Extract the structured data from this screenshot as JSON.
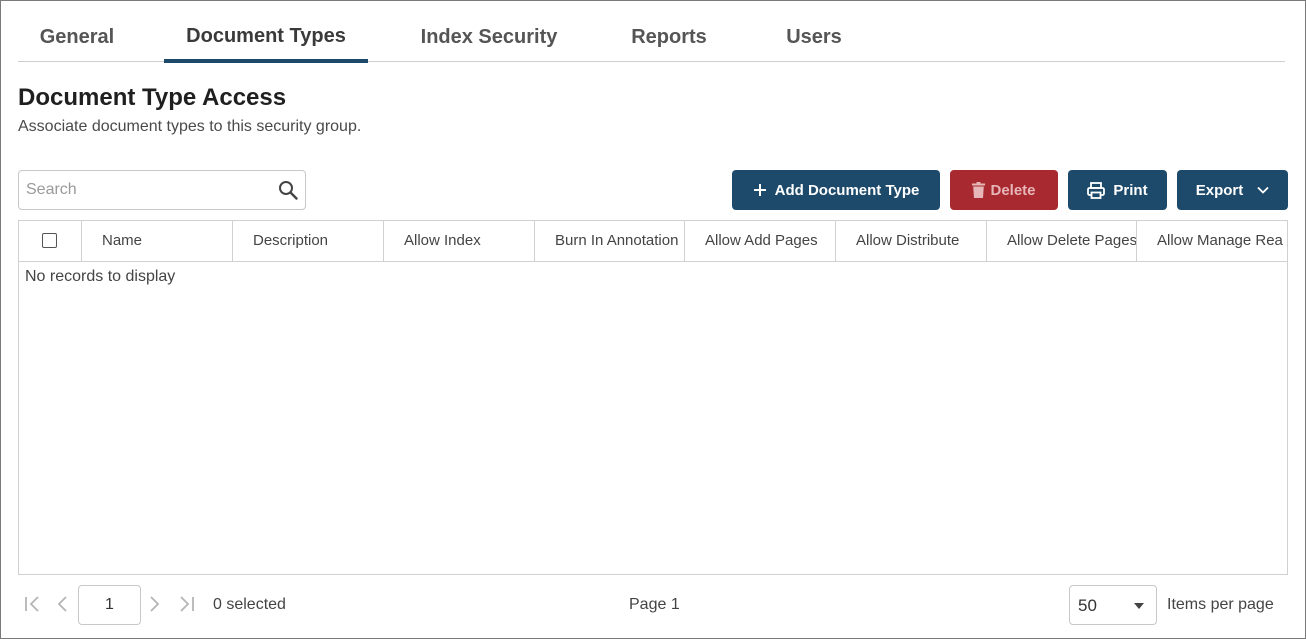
{
  "tabs": [
    {
      "label": "General",
      "active": false
    },
    {
      "label": "Document Types",
      "active": true
    },
    {
      "label": "Index Security",
      "active": false
    },
    {
      "label": "Reports",
      "active": false
    },
    {
      "label": "Users",
      "active": false
    }
  ],
  "page": {
    "title": "Document Type Access",
    "subtitle": "Associate document types to this security group."
  },
  "search": {
    "placeholder": "Search",
    "value": "",
    "icon": "search-icon"
  },
  "toolbar": {
    "add_label": "Add Document Type",
    "delete_label": "Delete",
    "print_label": "Print",
    "export_label": "Export"
  },
  "table": {
    "columns": [
      "Name",
      "Description",
      "Allow Index",
      "Burn In Annotation",
      "Allow Add Pages",
      "Allow Distribute",
      "Allow Delete Pages",
      "Allow Manage Rea"
    ],
    "rows": [],
    "empty_text": "No records to display"
  },
  "pager": {
    "current_page": "1",
    "selected_text": "0 selected",
    "page_label": "Page 1",
    "page_size": "50",
    "items_per_page_label": "Items per page"
  },
  "colors": {
    "primary": "#1d4a6b",
    "danger": "#a8292f"
  }
}
